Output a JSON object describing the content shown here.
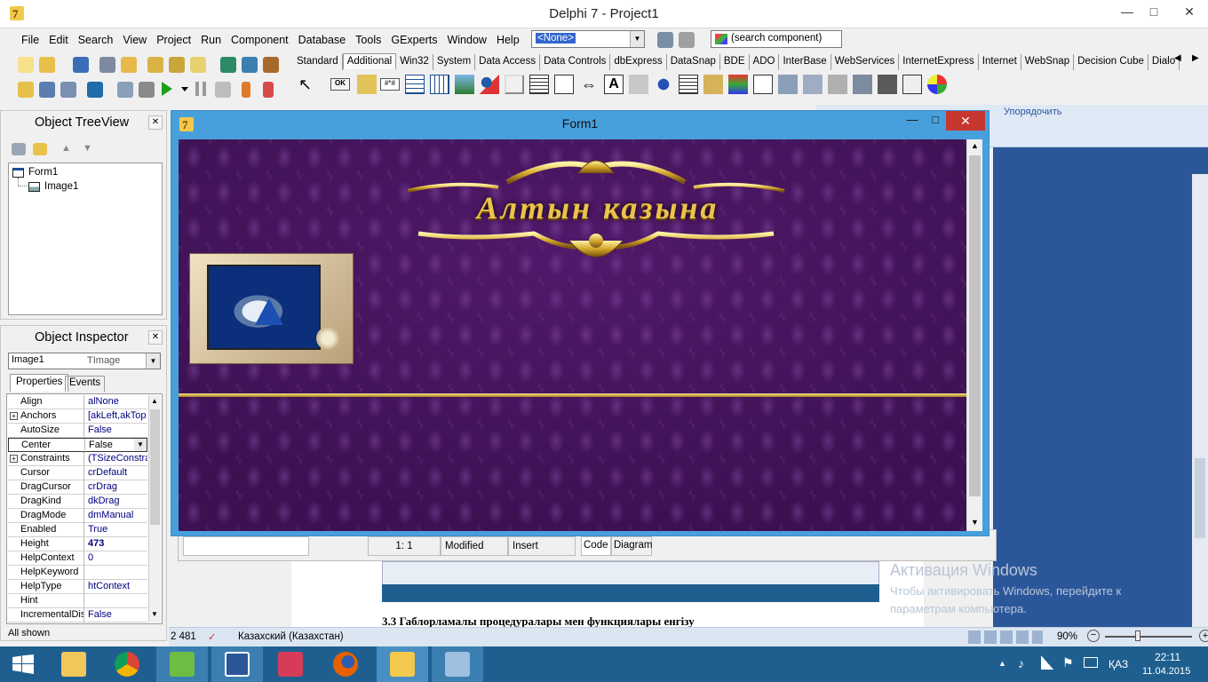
{
  "ide": {
    "title": "Delphi 7 - Project1",
    "menus": [
      "File",
      "Edit",
      "Search",
      "View",
      "Project",
      "Run",
      "Component",
      "Database",
      "Tools",
      "GExperts",
      "Window",
      "Help"
    ],
    "component_combo": "<None>",
    "search_component": "(search component)",
    "palette_tabs": [
      "Standard",
      "Additional",
      "Win32",
      "System",
      "Data Access",
      "Data Controls",
      "dbExpress",
      "DataSnap",
      "BDE",
      "ADO",
      "InterBase",
      "WebServices",
      "InternetExpress",
      "Internet",
      "WebSnap",
      "Decision Cube",
      "Dialo"
    ],
    "palette_selected": "Additional"
  },
  "tree": {
    "title": "Object TreeView",
    "root": "Form1",
    "child": "Image1"
  },
  "inspector": {
    "title": "Object Inspector",
    "object_name": "Image1",
    "object_type": "TImage",
    "tab_properties": "Properties",
    "tab_events": "Events",
    "rows": [
      {
        "k": "Align",
        "v": "alNone"
      },
      {
        "k": "Anchors",
        "v": "[akLeft,akTop"
      },
      {
        "k": "AutoSize",
        "v": "False"
      },
      {
        "k": "Center",
        "v": "False"
      },
      {
        "k": "Constraints",
        "v": "(TSizeConstra"
      },
      {
        "k": "Cursor",
        "v": "crDefault"
      },
      {
        "k": "DragCursor",
        "v": "crDrag"
      },
      {
        "k": "DragKind",
        "v": "dkDrag"
      },
      {
        "k": "DragMode",
        "v": "dmManual"
      },
      {
        "k": "Enabled",
        "v": "True"
      },
      {
        "k": "Height",
        "v": "473"
      },
      {
        "k": "HelpContext",
        "v": "0"
      },
      {
        "k": "HelpKeyword",
        "v": ""
      },
      {
        "k": "HelpType",
        "v": "htContext"
      },
      {
        "k": "Hint",
        "v": ""
      },
      {
        "k": "IncrementalDisp",
        "v": "False"
      }
    ],
    "footer": "All shown"
  },
  "form": {
    "title": "Form1",
    "banner_text": "Алтын казына"
  },
  "editor_status": {
    "pos": "1:   1",
    "modified": "Modified",
    "mode": "Insert",
    "tab_code": "Code",
    "tab_diagram": "Diagram"
  },
  "word": {
    "ribbon_label": "Упорядочить",
    "activation_title": "Активация Windows",
    "activation_line1": "Чтобы активировать Windows, перейдите к",
    "activation_line2": "параметрам компьютера.",
    "doc_heading": "3.3 Габлорламалы процедуралары мен функциялары енгізу",
    "status_words": "2 481",
    "status_lang": "Казахский (Казахстан)",
    "zoom": "90%"
  },
  "taskbar": {
    "lang": "ҚАЗ",
    "time": "22:11",
    "date": "11.04.2015"
  }
}
